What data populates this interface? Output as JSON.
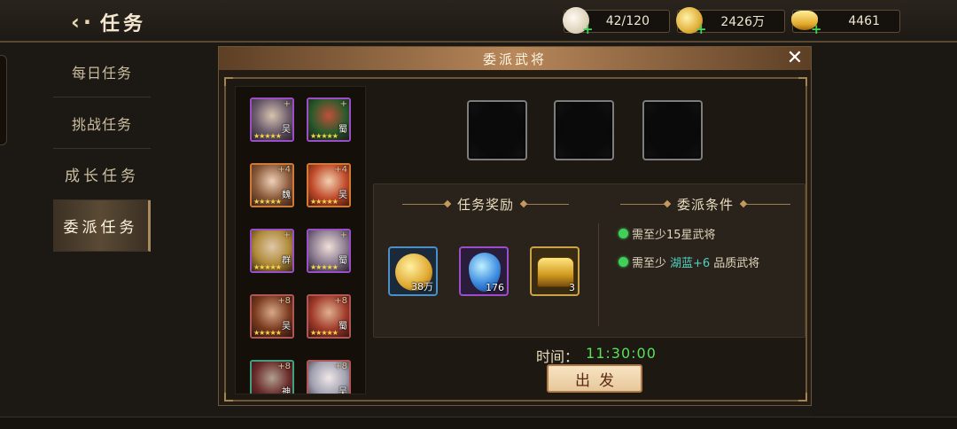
{
  "header": {
    "title": "任务",
    "back_icon": "back-arrow-icon"
  },
  "resources": [
    {
      "name": "bun",
      "value": "42/120",
      "icon": "bun-icon"
    },
    {
      "name": "coin",
      "value": "2426万",
      "icon": "coin-icon"
    },
    {
      "name": "gold_ingot",
      "value": "4461",
      "icon": "ingot-icon"
    }
  ],
  "sidebar": {
    "tabs": [
      {
        "label": "每日任务",
        "active": false
      },
      {
        "label": "挑战任务",
        "active": false
      },
      {
        "label": "成长任务",
        "active": false
      },
      {
        "label": "委派任务",
        "active": true
      }
    ]
  },
  "dialog": {
    "title": "委派武将",
    "heroes": [
      {
        "faction": "吴",
        "plus": "+",
        "frame": "purple"
      },
      {
        "faction": "蜀",
        "plus": "+",
        "frame": "purple"
      },
      {
        "faction": "魏",
        "plus": "+4",
        "frame": "orange"
      },
      {
        "faction": "吴",
        "plus": "+4",
        "frame": "orange"
      },
      {
        "faction": "群",
        "plus": "+",
        "frame": "purple"
      },
      {
        "faction": "蜀",
        "plus": "+",
        "frame": "purple"
      },
      {
        "faction": "吴",
        "plus": "+8",
        "frame": "red"
      },
      {
        "faction": "蜀",
        "plus": "+8",
        "frame": "red"
      },
      {
        "faction": "神",
        "plus": "+8",
        "frame": "green"
      },
      {
        "faction": "吴",
        "plus": "+8",
        "frame": "red"
      }
    ],
    "rewards_title": "任务奖励",
    "rewards": [
      {
        "count": "38万",
        "icon": "coin-icon",
        "frame": "blue"
      },
      {
        "count": "176",
        "icon": "blue-gem-icon",
        "frame": "purple"
      },
      {
        "count": "3",
        "icon": "treasure-chest-icon",
        "frame": "gold"
      }
    ],
    "conditions_title": "委派条件",
    "conditions": [
      {
        "prefix": "需至少15星武将",
        "highlight": "",
        "suffix": ""
      },
      {
        "prefix": "需至少",
        "highlight": "湖蓝+6",
        "suffix": "品质武将"
      }
    ],
    "time_label": "时间：",
    "time_value": "11:30:00",
    "depart_label": "出发"
  },
  "colors": {
    "accent_green": "#57e05a",
    "highlight_teal": "#52d1c0",
    "button_bg": "#f7e3c2"
  }
}
